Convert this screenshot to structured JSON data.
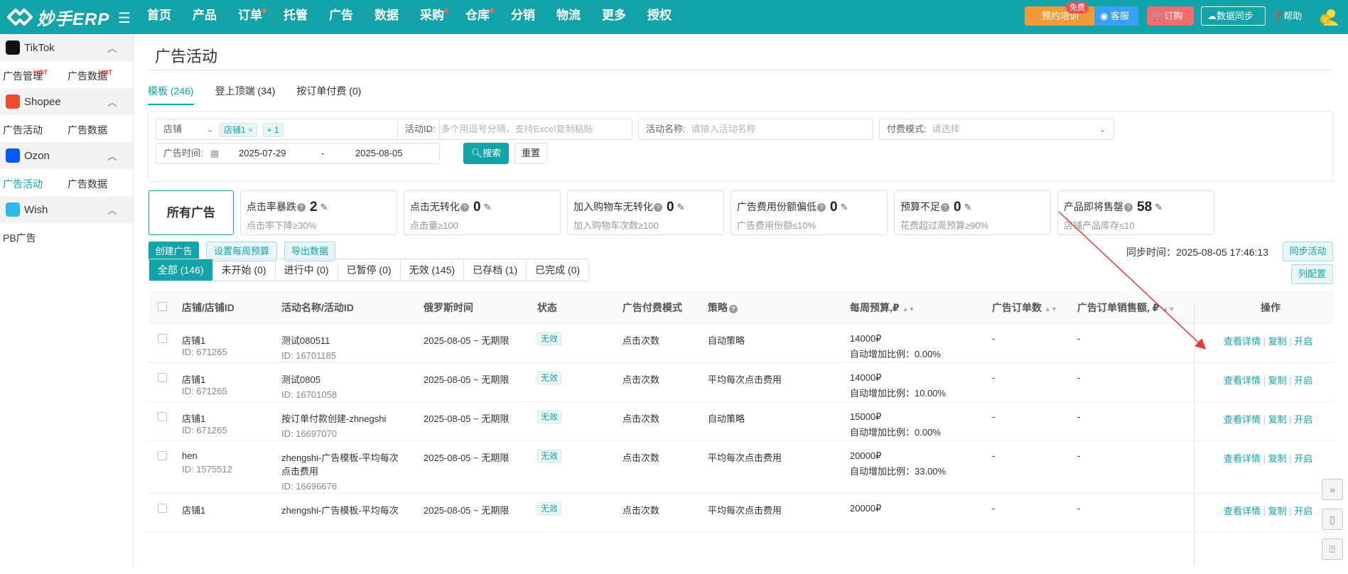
{
  "topbar": {
    "logo_text": "妙手ERP",
    "nav": [
      {
        "label": "首页",
        "dot": false
      },
      {
        "label": "产品",
        "dot": false
      },
      {
        "label": "订单",
        "dot": true
      },
      {
        "label": "托管",
        "dot": false
      },
      {
        "label": "广告",
        "dot": false
      },
      {
        "label": "数据",
        "dot": false
      },
      {
        "label": "采购",
        "dot": true
      },
      {
        "label": "仓库",
        "dot": true
      },
      {
        "label": "分销",
        "dot": false
      },
      {
        "label": "物流",
        "dot": false
      },
      {
        "label": "更多",
        "dot": false
      },
      {
        "label": "授权",
        "dot": false
      }
    ],
    "training": "预约培训",
    "free_tag": "免费",
    "service": "客服",
    "order": "订购",
    "sync": "数据同步",
    "help": "帮助",
    "avatar_letter": "V",
    "accent": "#12a4a9"
  },
  "sidebar": {
    "hot": "HOT",
    "groups": [
      {
        "name": "TikTok",
        "icon": "tiktok-icon",
        "color": "#111111",
        "items": [
          {
            "label": "广告管理",
            "hot": true,
            "active": false
          },
          {
            "label": "广告数据",
            "hot": true,
            "active": false
          }
        ]
      },
      {
        "name": "Shopee",
        "icon": "shopee-icon",
        "color": "#ee4d2d",
        "items": [
          {
            "label": "广告活动",
            "hot": false,
            "active": false
          },
          {
            "label": "广告数据",
            "hot": false,
            "active": false
          }
        ]
      },
      {
        "name": "Ozon",
        "icon": "ozon-icon",
        "color": "#005bff",
        "items": [
          {
            "label": "广告活动",
            "hot": false,
            "active": true
          },
          {
            "label": "广告数据",
            "hot": false,
            "active": false
          }
        ]
      },
      {
        "name": "Wish",
        "icon": "wish-icon",
        "color": "#2fb7ec",
        "items": [
          {
            "label": "PB广告",
            "hot": false,
            "active": false
          }
        ]
      }
    ]
  },
  "page": {
    "title": "广告活动",
    "tabs": [
      "模板 (246)",
      "登上顶端 (34)",
      "按订单付费 (0)"
    ]
  },
  "filters": {
    "store_label": "店铺",
    "store_chip": "店铺1",
    "store_more": "+ 1",
    "campaign_id_label": "活动ID:",
    "campaign_id_placeholder": "多个用逗号分隔，支持Excel复制粘贴",
    "campaign_name_label": "活动名称:",
    "campaign_name_placeholder": "请输入活动名称",
    "pay_mode_label": "付费模式:",
    "pay_mode_placeholder": "请选择",
    "date_label": "广告时间:",
    "date_from": "2025-07-29",
    "date_sep": "-",
    "date_to": "2025-08-05",
    "search": "搜索",
    "reset": "重置"
  },
  "stats": {
    "all": "所有广告",
    "cards": [
      {
        "label": "点击率暴跌",
        "value": "2",
        "sub": "点击率下降≥30%"
      },
      {
        "label": "点击无转化",
        "value": "0",
        "sub": "点击量≥100"
      },
      {
        "label": "加入购物车无转化",
        "value": "0",
        "sub": "加入购物车次数≥100"
      },
      {
        "label": "广告费用份额偏低",
        "value": "0",
        "sub": "广告费用份额≤10%"
      },
      {
        "label": "预算不足",
        "value": "0",
        "sub": "花费超过周预算≥90%"
      },
      {
        "label": "产品即将售罄",
        "value": "58",
        "sub": "店铺产品库存≤10"
      }
    ]
  },
  "actions": {
    "create": "创建广告",
    "weekly_budget": "设置每周预算",
    "export": "导出数据",
    "sync_time_label": "同步时间：2025-08-05 17:46:13",
    "sync_campaign": "同步活动",
    "columns_config": "列配置"
  },
  "status_tabs": [
    "全部 (146)",
    "未开始 (0)",
    "进行中 (0)",
    "已暂停 (0)",
    "无效 (145)",
    "已存档 (1)",
    "已完成 (0)"
  ],
  "table": {
    "headers": {
      "store": "店铺/店铺ID",
      "campaign": "活动名称/活动ID",
      "time": "俄罗斯时间",
      "status": "状态",
      "pay_mode": "广告付费模式",
      "strategy": "策略",
      "budget": "每周预算,₽",
      "orders": "广告订单数",
      "sales": "广告订单销售额, ₽",
      "ops": "操作"
    },
    "rows": [
      {
        "store": "店铺1",
        "store_id": "ID:  671265",
        "name": "测试080511",
        "name2": "",
        "cid": "ID:  16701185",
        "time": "2025-08-05 ~ 无期限",
        "status": "无效",
        "pay": "点击次数",
        "strategy": "自动策略",
        "budget": "14000₽",
        "auto": "自动增加比例：0.00%",
        "orders": "-",
        "sales": "-"
      },
      {
        "store": "店铺1",
        "store_id": "ID:  671265",
        "name": "测试0805",
        "name2": "",
        "cid": "ID:  16701058",
        "time": "2025-08-05 ~ 无期限",
        "status": "无效",
        "pay": "点击次数",
        "strategy": "平均每次点击费用",
        "budget": "14000₽",
        "auto": "自动增加比例：10.00%",
        "orders": "-",
        "sales": "-"
      },
      {
        "store": "店铺1",
        "store_id": "ID:  671265",
        "name": "按订单付款创建-zhnegshi",
        "name2": "",
        "cid": "ID:  16697070",
        "time": "2025-08-05 ~ 无期限",
        "status": "无效",
        "pay": "点击次数",
        "strategy": "自动策略",
        "budget": "15000₽",
        "auto": "自动增加比例：0.00%",
        "orders": "-",
        "sales": "-"
      },
      {
        "store": "hen",
        "store_id": "ID:  1575512",
        "name": "zhengshi-广告模板-平均每次",
        "name2": "点击费用",
        "cid": "ID:  16696676",
        "time": "2025-08-05 ~ 无期限",
        "status": "无效",
        "pay": "点击次数",
        "strategy": "平均每次点击费用",
        "budget": "20000₽",
        "auto": "自动增加比例：33.00%",
        "orders": "-",
        "sales": "-"
      },
      {
        "store": "店铺1",
        "store_id": "",
        "name": "zhengshi-广告模板-平均每次",
        "name2": "",
        "cid": "",
        "time": "2025-08-05 ~ 无期限",
        "status": "无效",
        "pay": "点击次数",
        "strategy": "平均每次点击费用",
        "budget": "20000₽",
        "auto": "",
        "orders": "-",
        "sales": "-"
      }
    ],
    "ops": {
      "view": "查看详情",
      "copy": "复制",
      "enable": "开启"
    }
  }
}
